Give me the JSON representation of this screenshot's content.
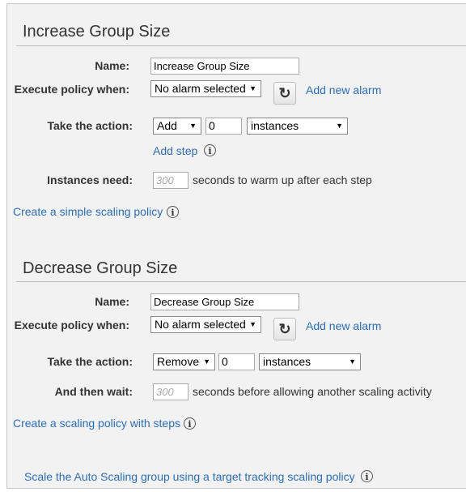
{
  "increase": {
    "title": "Increase Group Size",
    "name_label": "Name:",
    "name_value": "Increase Group Size",
    "execute_label": "Execute policy when:",
    "alarm_select": "No alarm selected",
    "add_alarm": "Add new alarm",
    "action_label": "Take the action:",
    "action_select": "Add",
    "action_value": "0",
    "unit_select": "instances",
    "add_step": "Add step",
    "instances_label": "Instances need:",
    "warmup_placeholder": "300",
    "warmup_text": "seconds to warm up after each step",
    "simple_link": "Create a simple scaling policy"
  },
  "decrease": {
    "title": "Decrease Group Size",
    "name_label": "Name:",
    "name_value": "Decrease Group Size",
    "execute_label": "Execute policy when:",
    "alarm_select": "No alarm selected",
    "add_alarm": "Add new alarm",
    "action_label": "Take the action:",
    "action_select": "Remove",
    "action_value": "0",
    "unit_select": "instances",
    "wait_label": "And then wait:",
    "wait_placeholder": "300",
    "wait_text": "seconds before allowing another scaling activity",
    "steps_link": "Create a scaling policy with steps"
  },
  "footer": {
    "target_link": "Scale the Auto Scaling group using a target tracking scaling policy"
  },
  "icons": {
    "dropdown": "▼",
    "refresh": "↻",
    "info": "i"
  }
}
